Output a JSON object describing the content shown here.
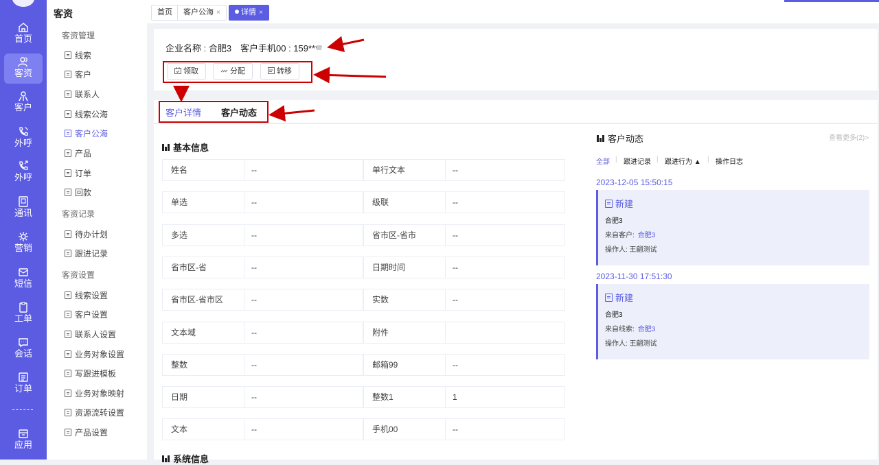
{
  "rail": {
    "items": [
      {
        "label": "首页",
        "icon": "home-icon"
      },
      {
        "label": "客资",
        "icon": "users-icon",
        "active": true
      },
      {
        "label": "客户",
        "icon": "user-icon"
      },
      {
        "label": "外呼",
        "icon": "phone-call-icon"
      },
      {
        "label": "外呼",
        "icon": "phone-out-icon"
      },
      {
        "label": "通讯",
        "icon": "address-book-icon"
      },
      {
        "label": "营销",
        "icon": "marketing-icon"
      },
      {
        "label": "短信",
        "icon": "sms-icon"
      },
      {
        "label": "工单",
        "icon": "ticket-icon"
      },
      {
        "label": "会话",
        "icon": "chat-icon"
      },
      {
        "label": "订单",
        "icon": "order-icon"
      },
      {
        "label": "应用",
        "icon": "apps-icon"
      }
    ]
  },
  "sidebar": {
    "title": "客资",
    "groups": [
      {
        "title": "客资管理",
        "items": [
          "线索",
          "客户",
          "联系人",
          "线索公海",
          "客户公海",
          "产品",
          "订单",
          "回款"
        ]
      },
      {
        "title": "客资记录",
        "items": [
          "待办计划",
          "跟进记录"
        ]
      },
      {
        "title": "客资设置",
        "items": [
          "线索设置",
          "客户设置",
          "联系人设置",
          "业务对象设置",
          "写跟进模板",
          "业务对象映射",
          "资源流转设置",
          "产品设置"
        ]
      }
    ],
    "active_item": "客户公海"
  },
  "tabs": {
    "home": "首页",
    "pool": "客户公海",
    "detail": "详情",
    "close": "×"
  },
  "header": {
    "company": "企业名称 : 合肥3",
    "phone": "客户手机00 : 159****",
    "actions": [
      {
        "label": "领取",
        "icon": "claim-icon"
      },
      {
        "label": "分配",
        "icon": "assign-icon"
      },
      {
        "label": "转移",
        "icon": "transfer-icon"
      }
    ]
  },
  "detail_tabs": {
    "detail": "客户详情",
    "activity": "客户动态"
  },
  "basic_info": {
    "title": "基本信息",
    "rows": [
      [
        "姓名",
        "--",
        "单行文本",
        "--"
      ],
      [
        "单选",
        "--",
        "级联",
        "--"
      ],
      [
        "多选",
        "--",
        "省市区-省市",
        "--"
      ],
      [
        "省市区-省",
        "--",
        "日期时间",
        "--"
      ],
      [
        "省市区-省市区",
        "--",
        "实数",
        "--"
      ],
      [
        "文本域",
        "--",
        "附件",
        ""
      ],
      [
        "整数",
        "--",
        "邮箱99",
        "--"
      ],
      [
        "日期",
        "--",
        "整数1",
        "1"
      ],
      [
        "文本",
        "--",
        "手机00",
        "--"
      ]
    ]
  },
  "system_info": {
    "title": "系统信息"
  },
  "activity": {
    "title": "客户动态",
    "more": "查看更多(2)>",
    "filters": [
      "全部",
      "跟进记录",
      "跟进行为 ▲",
      "操作日志"
    ],
    "entries": [
      {
        "date": "2023-12-05 15:50:15",
        "type": "新建",
        "name": "合肥3",
        "source_label": "来自客户:",
        "source_value": "合肥3",
        "operator": "操作人: 王翩测试"
      },
      {
        "date": "2023-11-30 17:51:30",
        "type": "新建",
        "name": "合肥3",
        "source_label": "来自线索:",
        "source_value": "合肥3",
        "operator": "操作人: 王翩测试"
      }
    ]
  },
  "colors": {
    "accent": "#5b5ce2",
    "annotation": "#cc0000"
  }
}
